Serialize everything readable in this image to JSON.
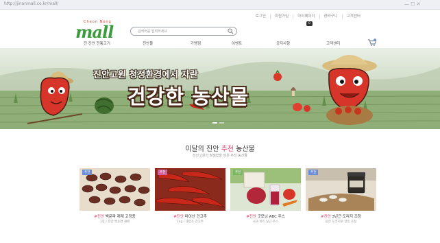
{
  "browser": {
    "url": "http://jinanmall.co.kr/mall/",
    "controls": "— ☐ ✕"
  },
  "top_menu": [
    "로그인",
    "회원가입",
    "마이페이지",
    "장바구니",
    "고객센터"
  ],
  "cart_badge": "0",
  "logo": {
    "small_text": "Cheon Nong",
    "text": "mall"
  },
  "search": {
    "placeholder": "검색어를 입력하세요"
  },
  "nav": [
    "전 진안 전통고기",
    "진안몰",
    "가맹점",
    "이벤트",
    "공지사항",
    "고객센터"
  ],
  "hero": {
    "headline_1": "진안고원 청정환경에서 자란",
    "headline_2": "건강한 농산물"
  },
  "section": {
    "title_pre": "이달의 진안 ",
    "title_highlight": "추천",
    "title_post": " 농산물",
    "subtitle": "진안고원의 청정함을 담은 추천 농산물"
  },
  "products": [
    {
      "tag": "추천",
      "tag_color": "#6a8fd8",
      "prefix": "#진안",
      "name": " 백운파 재래 고정종",
      "desc": "1봉 / 진안 백운면 재배"
    },
    {
      "tag": "추천",
      "tag_color": "#d060a0",
      "prefix": "#진안",
      "name": " 마이산 건고추",
      "desc": "1kg / 태양초 건고추"
    },
    {
      "tag": "추천",
      "tag_color": "#7cb860",
      "prefix": "#진안",
      "name": " 굿모닝 ABC 주스",
      "desc": "사과 비트 당근 주스"
    },
    {
      "tag": "추천",
      "tag_color": "#6a8fd8",
      "prefix": "#진안",
      "name": " 3년근 도라지 조청",
      "desc": "진안 도라지로 만든 조청"
    }
  ],
  "colors": {
    "accent": "#e0406a",
    "logo_green": "#3c9b3c"
  }
}
